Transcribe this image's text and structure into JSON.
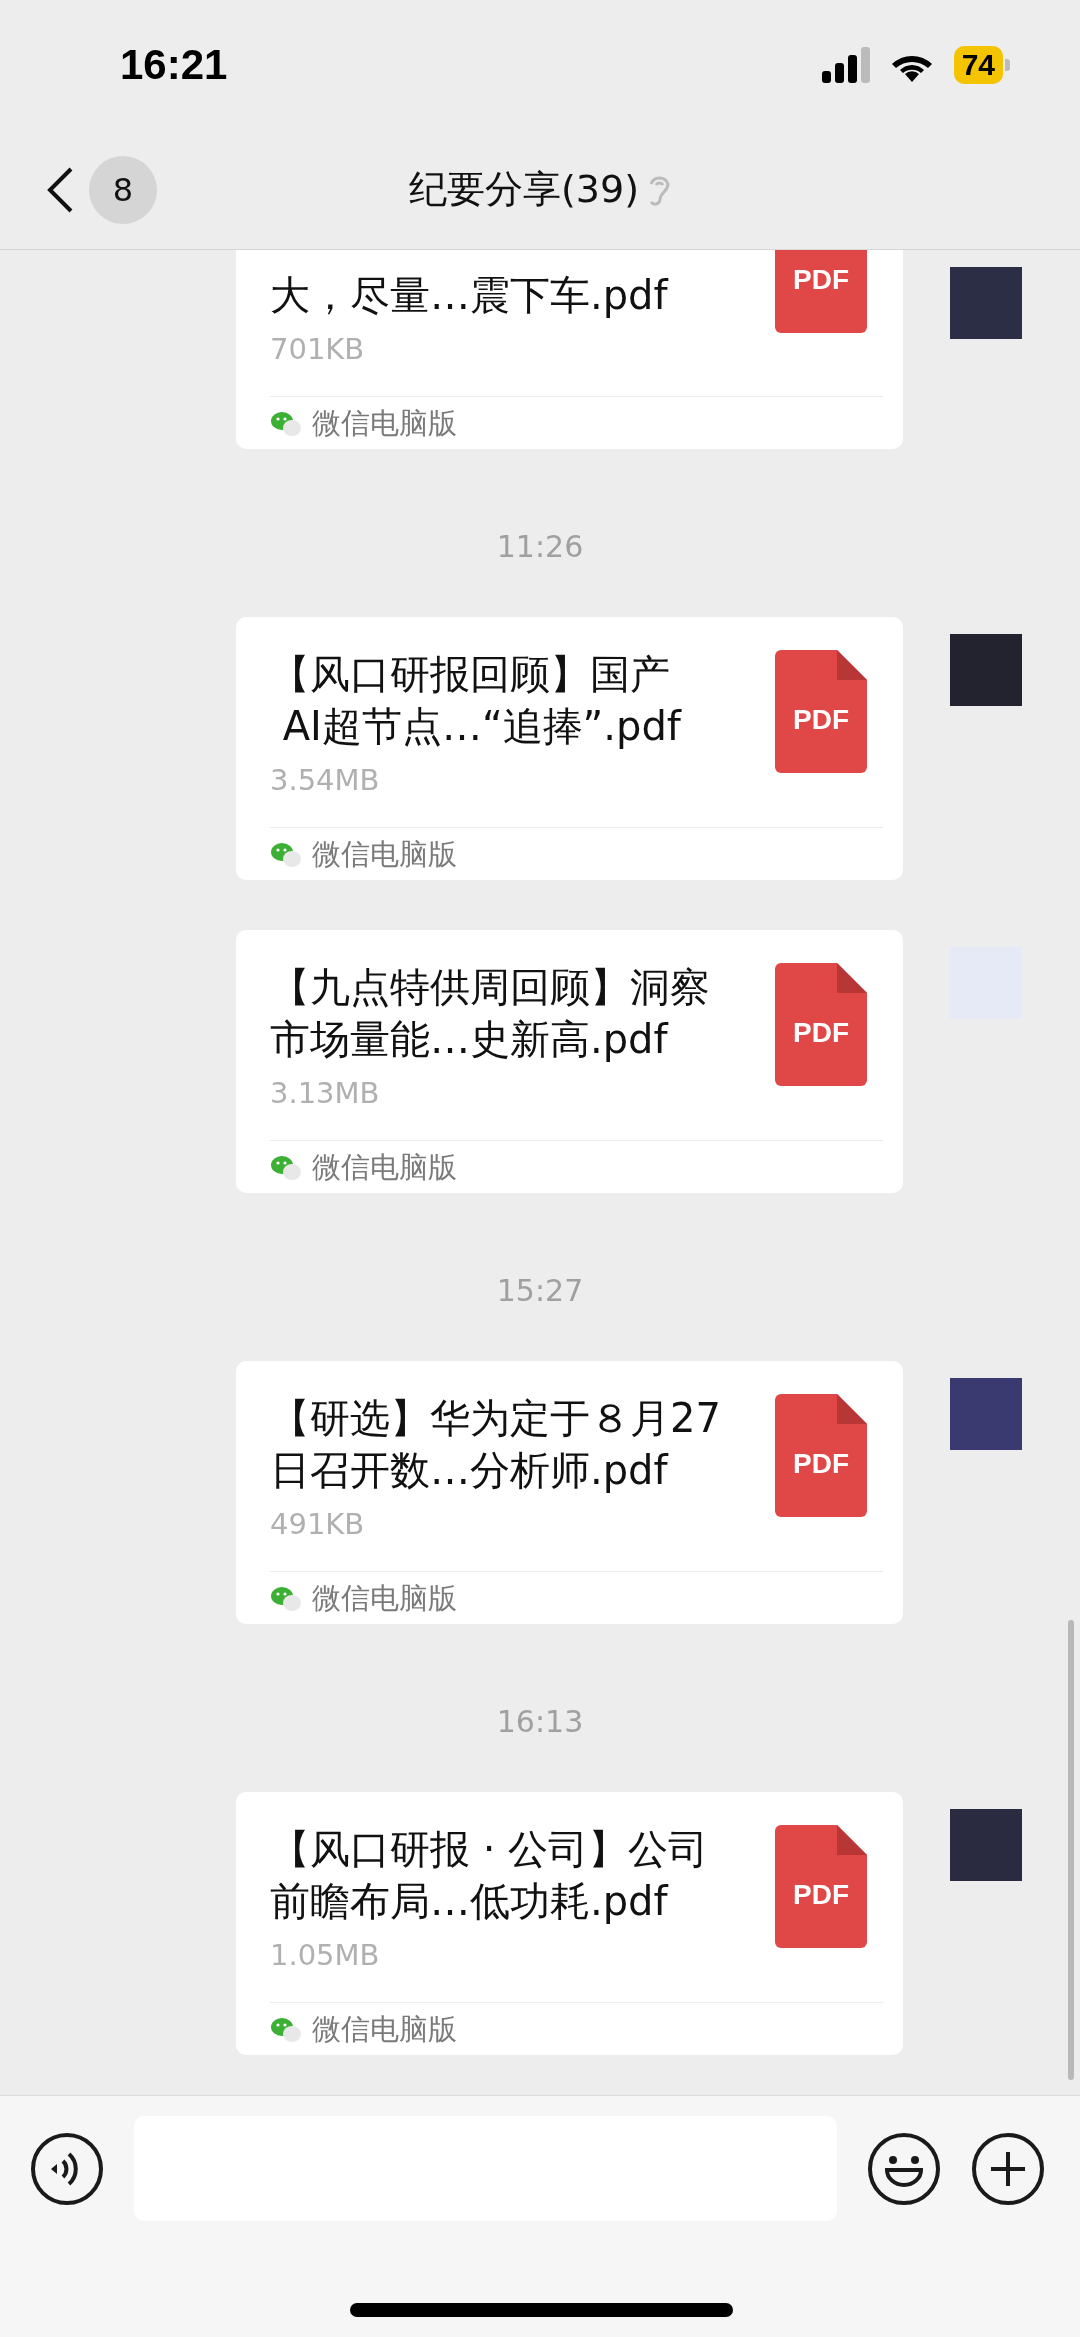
{
  "status_bar": {
    "time": "16:21",
    "battery": "74"
  },
  "nav": {
    "back_badge": "8",
    "title": "纪要分享(39)"
  },
  "chat": [
    {
      "kind": "file",
      "title_lines": [
        "大，尽量…震下车.pdf"
      ],
      "size": "701KB",
      "source": "微信电脑版",
      "file_type": "PDF",
      "color": "#2b2e45"
    },
    {
      "kind": "timestamp",
      "text": "11:26"
    },
    {
      "kind": "file",
      "title_lines": [
        "【风口研报回顾】国产",
        " AI超节点…“追捧”.pdf"
      ],
      "size": "3.54MB",
      "source": "微信电脑版",
      "file_type": "PDF",
      "color": "#23232f"
    },
    {
      "kind": "file",
      "title_lines": [
        "【九点特供周回顾】洞察",
        "市场量能…史新高.pdf"
      ],
      "size": "3.13MB",
      "source": "微信电脑版",
      "file_type": "PDF",
      "color": "#e6eaf6"
    },
    {
      "kind": "timestamp",
      "text": "15:27"
    },
    {
      "kind": "file",
      "title_lines": [
        "【研选】华为定于８月27",
        "日召开数…分析师.pdf"
      ],
      "size": "491KB",
      "source": "微信电脑版",
      "file_type": "PDF",
      "color": "#3a3a70"
    },
    {
      "kind": "timestamp",
      "text": "16:13"
    },
    {
      "kind": "file",
      "title_lines": [
        "【风口研报 · 公司】公司",
        "前瞻布局…低功耗.pdf"
      ],
      "size": "1.05MB",
      "source": "微信电脑版",
      "file_type": "PDF",
      "color": "#2a2a40"
    }
  ]
}
